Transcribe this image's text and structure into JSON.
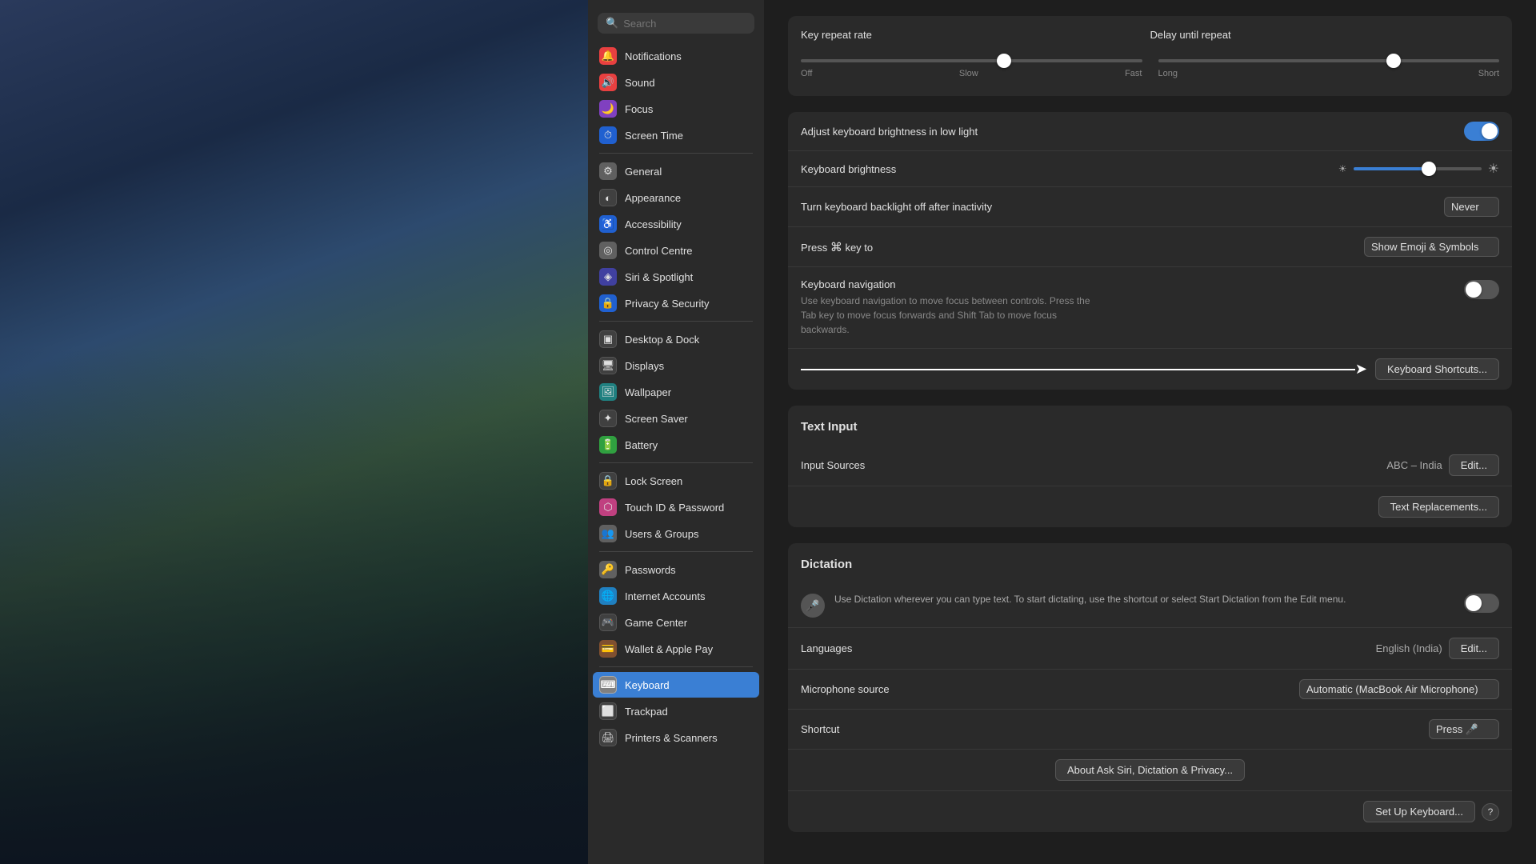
{
  "wallpaper": {
    "alt": "macOS Sonoma landscape wallpaper"
  },
  "search": {
    "placeholder": "Search"
  },
  "sidebar": {
    "items_group1": [
      {
        "id": "notifications",
        "label": "Notifications",
        "icon": "🔔",
        "iconClass": "icon-red"
      },
      {
        "id": "sound",
        "label": "Sound",
        "icon": "🔊",
        "iconClass": "icon-red"
      },
      {
        "id": "focus",
        "label": "Focus",
        "icon": "🌙",
        "iconClass": "icon-purple"
      },
      {
        "id": "screen-time",
        "label": "Screen Time",
        "icon": "⏱",
        "iconClass": "icon-blue"
      }
    ],
    "items_group2": [
      {
        "id": "general",
        "label": "General",
        "icon": "⚙",
        "iconClass": "icon-gray"
      },
      {
        "id": "appearance",
        "label": "Appearance",
        "icon": "◐",
        "iconClass": "icon-dark"
      },
      {
        "id": "accessibility",
        "label": "Accessibility",
        "icon": "♿",
        "iconClass": "icon-blue"
      },
      {
        "id": "control-centre",
        "label": "Control Centre",
        "icon": "◎",
        "iconClass": "icon-gray"
      },
      {
        "id": "siri",
        "label": "Siri & Spotlight",
        "icon": "◈",
        "iconClass": "icon-indigo"
      },
      {
        "id": "privacy",
        "label": "Privacy & Security",
        "icon": "🔒",
        "iconClass": "icon-blue"
      }
    ],
    "items_group3": [
      {
        "id": "desktop-dock",
        "label": "Desktop & Dock",
        "icon": "▣",
        "iconClass": "icon-dark"
      },
      {
        "id": "displays",
        "label": "Displays",
        "icon": "🖥",
        "iconClass": "icon-dark"
      },
      {
        "id": "wallpaper",
        "label": "Wallpaper",
        "icon": "🖼",
        "iconClass": "icon-teal"
      },
      {
        "id": "screen-saver",
        "label": "Screen Saver",
        "icon": "✦",
        "iconClass": "icon-dark"
      },
      {
        "id": "battery",
        "label": "Battery",
        "icon": "🔋",
        "iconClass": "icon-green"
      }
    ],
    "items_group4": [
      {
        "id": "lock-screen",
        "label": "Lock Screen",
        "icon": "🔒",
        "iconClass": "icon-dark"
      },
      {
        "id": "touch-id",
        "label": "Touch ID & Password",
        "icon": "⬡",
        "iconClass": "icon-pink"
      },
      {
        "id": "users-groups",
        "label": "Users & Groups",
        "icon": "👥",
        "iconClass": "icon-gray"
      }
    ],
    "items_group5": [
      {
        "id": "passwords",
        "label": "Passwords",
        "icon": "🔑",
        "iconClass": "icon-gray"
      },
      {
        "id": "internet-accounts",
        "label": "Internet Accounts",
        "icon": "🌐",
        "iconClass": "icon-lightblue"
      },
      {
        "id": "game-center",
        "label": "Game Center",
        "icon": "🎮",
        "iconClass": "icon-dark"
      },
      {
        "id": "wallet",
        "label": "Wallet & Apple Pay",
        "icon": "💳",
        "iconClass": "icon-brown"
      }
    ],
    "items_group6": [
      {
        "id": "keyboard",
        "label": "Keyboard",
        "icon": "⌨",
        "iconClass": "icon-dark",
        "active": true
      },
      {
        "id": "trackpad",
        "label": "Trackpad",
        "icon": "⬜",
        "iconClass": "icon-dark"
      },
      {
        "id": "printers-scanners",
        "label": "Printers & Scanners",
        "icon": "🖨",
        "iconClass": "icon-dark"
      }
    ]
  },
  "main": {
    "key_repeat": {
      "label": "Key repeat rate",
      "delay_label": "Delay until repeat",
      "slow_label": "Off",
      "label2": "Slow",
      "fast_label": "Fast",
      "long_label": "Long",
      "short_label": "Short",
      "repeat_value": 60,
      "delay_value": 70
    },
    "keyboard_brightness": {
      "label": "Adjust keyboard brightness in low light",
      "toggle_state": "on",
      "brightness_label": "Keyboard brightness",
      "brightness_value": 60
    },
    "backlight": {
      "label": "Turn keyboard backlight off after inactivity",
      "value": "Never"
    },
    "press_key": {
      "label": "Press",
      "globe_symbol": "⌘",
      "key_to": "key to",
      "value": "Show Emoji & Symbols"
    },
    "keyboard_nav": {
      "label": "Keyboard navigation",
      "description": "Use keyboard navigation to move focus between controls. Press the Tab key to move focus forwards and Shift Tab to move focus backwards.",
      "toggle_state": "off"
    },
    "keyboard_shortcuts_btn": "Keyboard Shortcuts...",
    "text_input": {
      "title": "Text Input",
      "input_sources_label": "Input Sources",
      "input_sources_value": "ABC – India",
      "edit_btn": "Edit...",
      "text_replacements_btn": "Text Replacements..."
    },
    "dictation": {
      "title": "Dictation",
      "description": "Use Dictation wherever you can type text. To start dictating, use the shortcut or select Start Dictation from the Edit menu.",
      "toggle_state": "off",
      "languages_label": "Languages",
      "languages_value": "English (India)",
      "languages_edit_btn": "Edit...",
      "microphone_label": "Microphone source",
      "microphone_value": "Automatic (MacBook Air Microphone)",
      "shortcut_label": "Shortcut",
      "shortcut_value": "Press",
      "mic_symbol": "🎤",
      "about_btn": "About Ask Siri, Dictation & Privacy...",
      "setup_btn": "Set Up Keyboard...",
      "help_label": "?"
    }
  }
}
